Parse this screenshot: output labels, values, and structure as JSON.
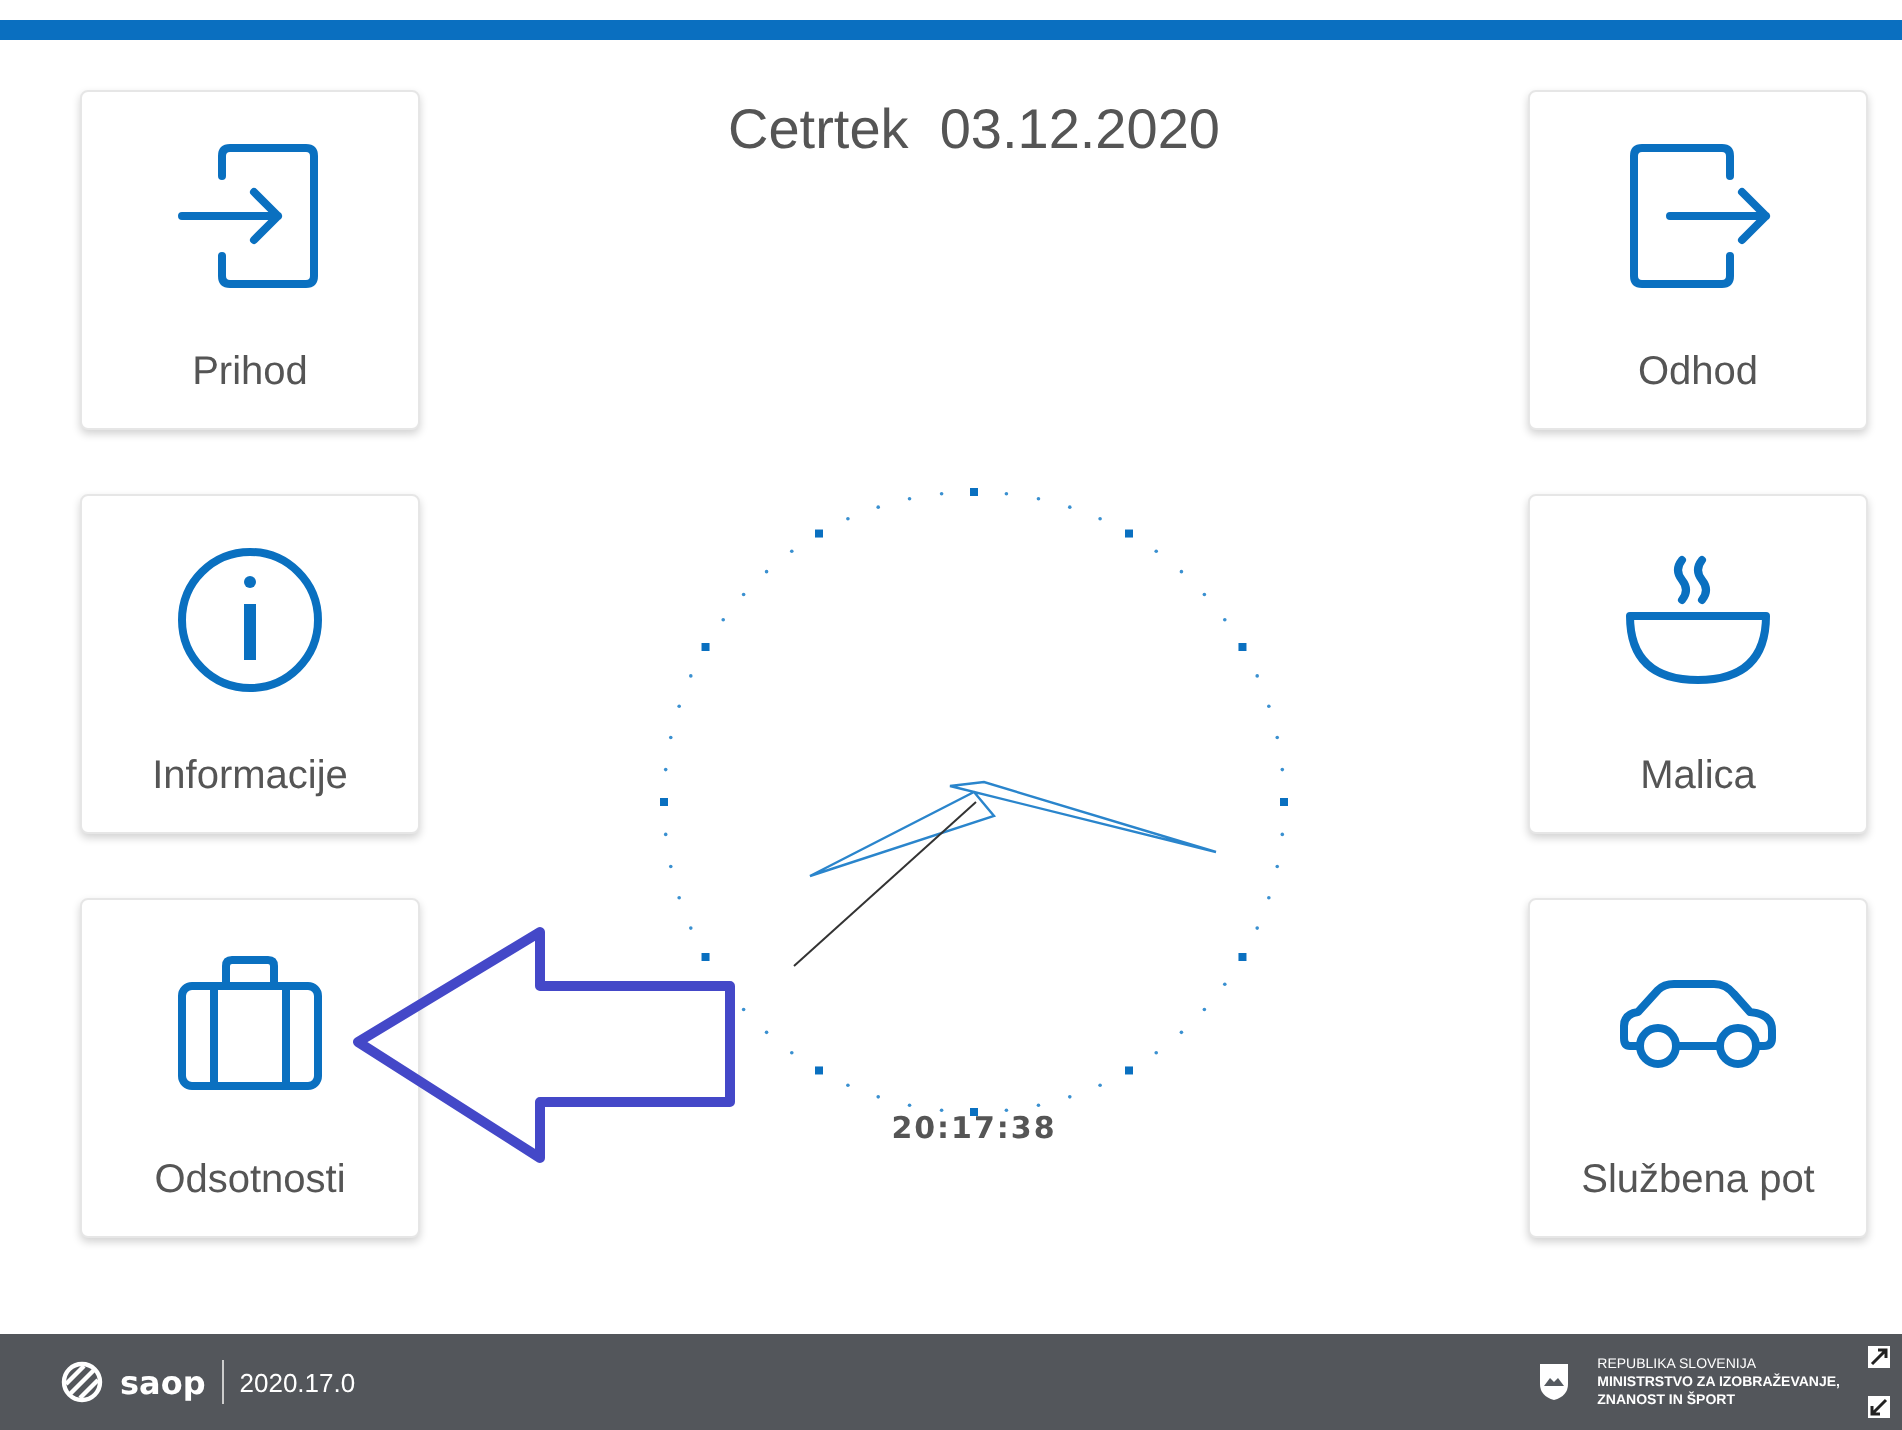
{
  "date": "Cetrtek  03.12.2020",
  "left_tiles": [
    {
      "kind": "arrival",
      "label": "Prihod"
    },
    {
      "kind": "info",
      "label": "Informacije"
    },
    {
      "kind": "absence",
      "label": "Odsotnosti"
    }
  ],
  "right_tiles": [
    {
      "kind": "departure",
      "label": "Odhod"
    },
    {
      "kind": "meal",
      "label": "Malica"
    },
    {
      "kind": "trip",
      "label": "Službena pot"
    }
  ],
  "clock": {
    "time": "20:17:38"
  },
  "footer": {
    "brand": "saop",
    "version": "2020.17.0",
    "ministry_lines": [
      "REPUBLIKA SLOVENIJA",
      "MINISTRSTVO ZA IZOBRAŽEVANJE,",
      "ZNANOST IN ŠPORT"
    ]
  }
}
